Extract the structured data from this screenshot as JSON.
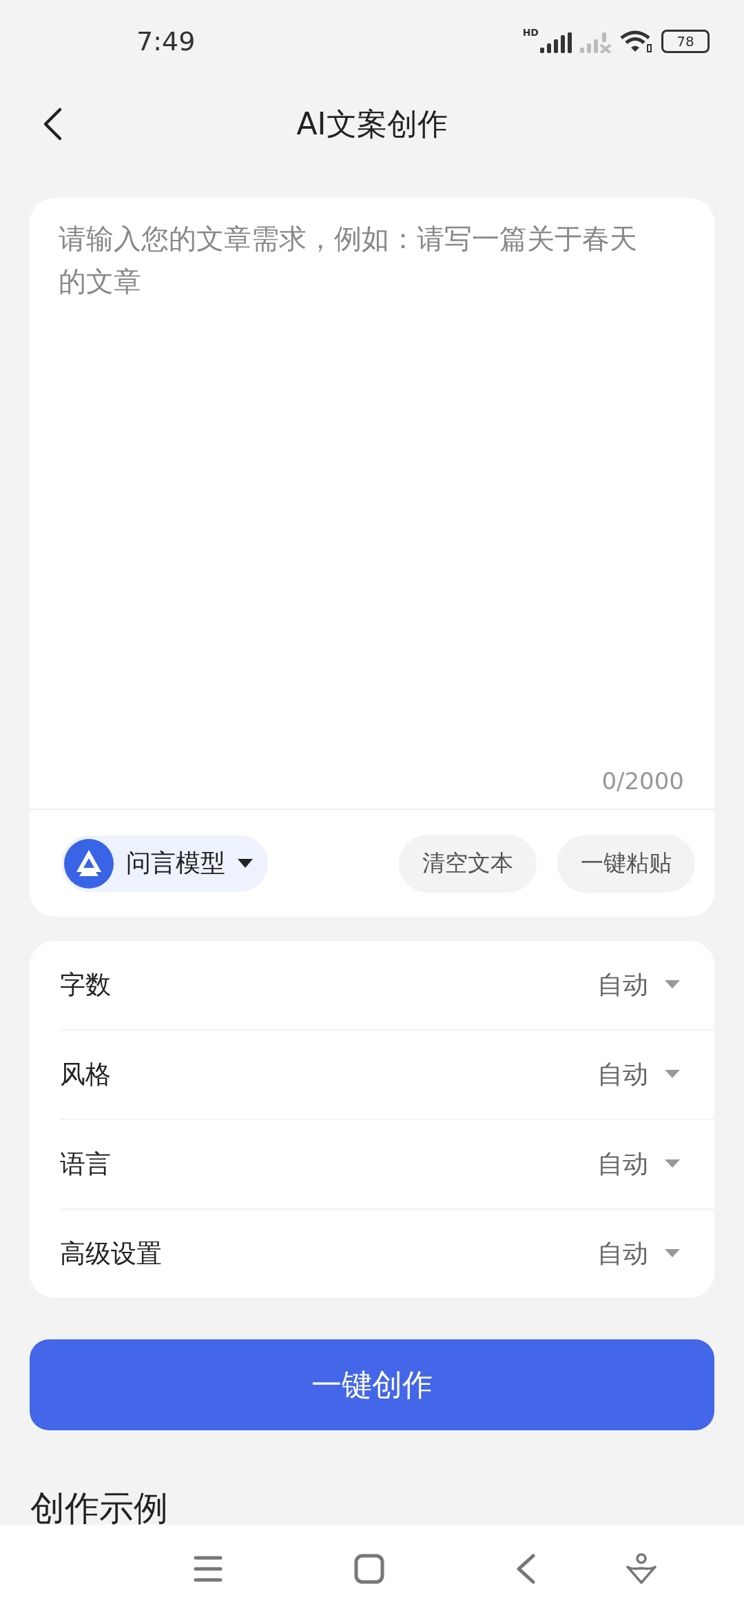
{
  "status_bar": {
    "time": "7:49",
    "network_label": "HD",
    "battery": "78"
  },
  "header": {
    "title": "AI文案创作"
  },
  "editor": {
    "placeholder": "请输入您的文章需求，例如：请写一篇关于春天的文章",
    "counter": "0/2000"
  },
  "model_selector": {
    "label": "问言模型"
  },
  "editor_actions": [
    "清空文本",
    "一键粘贴"
  ],
  "settings": [
    {
      "label": "字数",
      "value": "自动"
    },
    {
      "label": "风格",
      "value": "自动"
    },
    {
      "label": "语言",
      "value": "自动"
    },
    {
      "label": "高级设置",
      "value": "自动"
    }
  ],
  "submit_button": "一键创作",
  "section_heading": "创作示例"
}
